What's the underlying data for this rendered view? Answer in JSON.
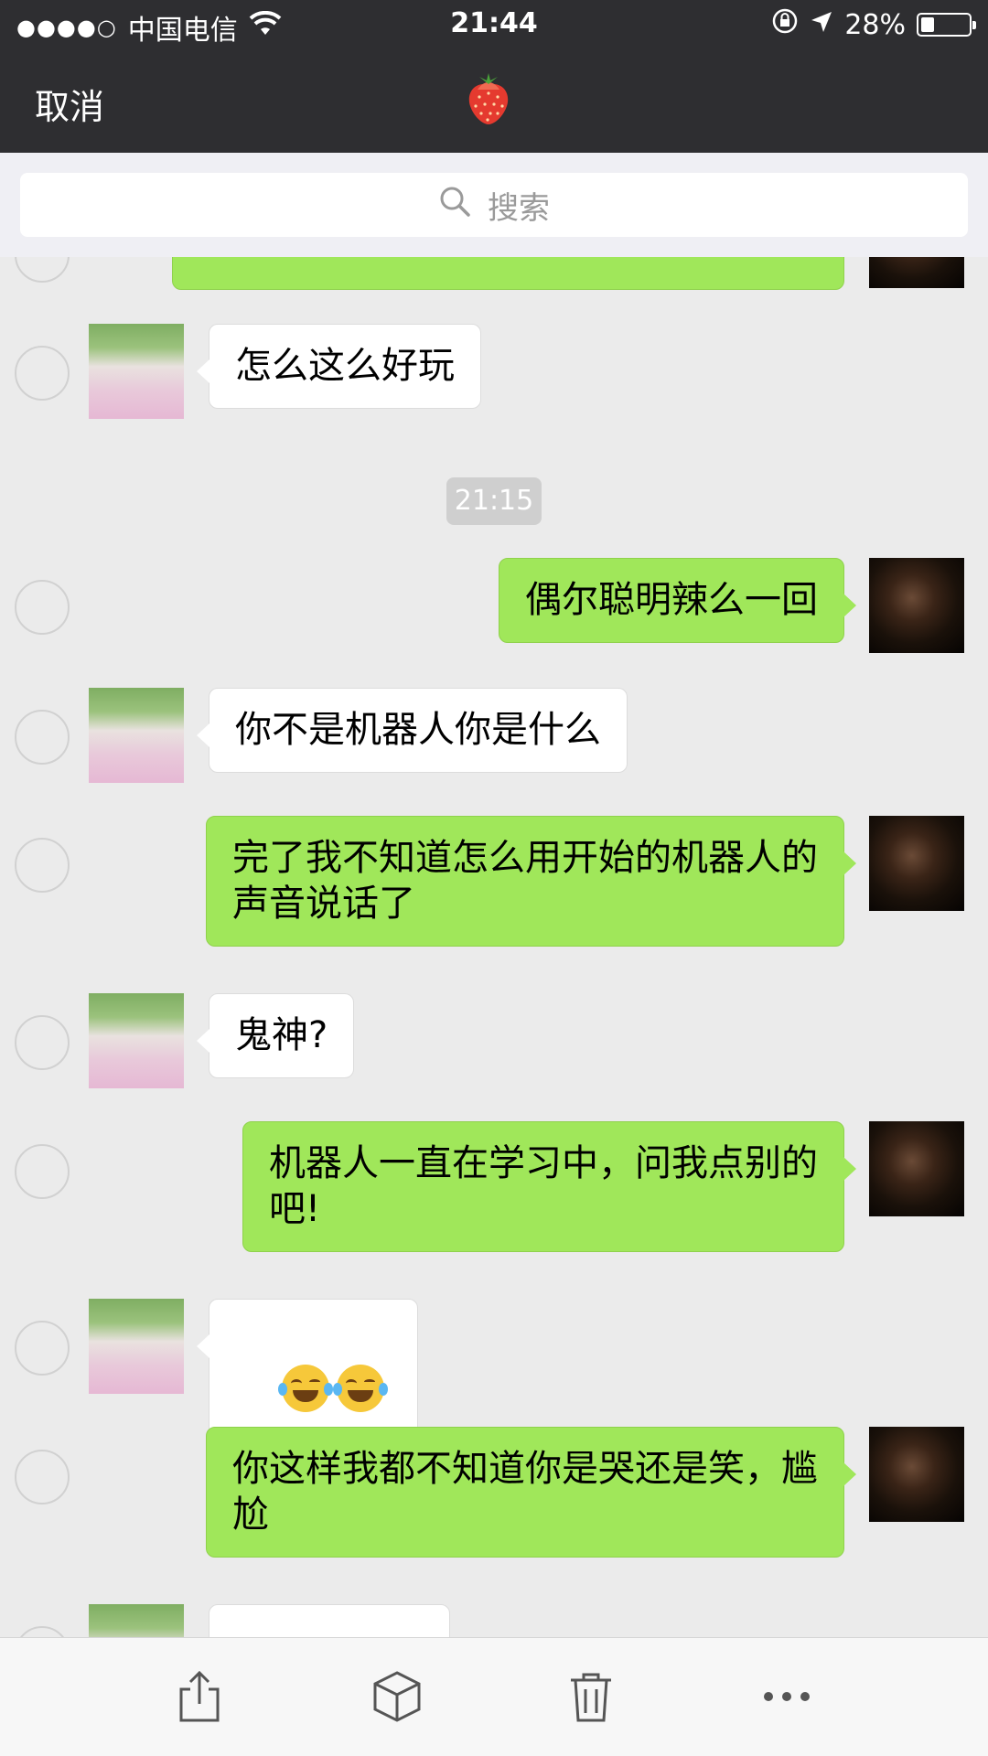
{
  "status_bar": {
    "signal": "●●●●○",
    "carrier": "中国电信",
    "time": "21:44",
    "battery": "28%",
    "battery_level": 0.28
  },
  "nav": {
    "cancel_label": "取消",
    "title_icon": "strawberry-icon"
  },
  "search": {
    "placeholder": "搜索"
  },
  "chat": {
    "timestamp": "21:15",
    "messages": [
      {
        "side": "left",
        "text": "怎么这么好玩"
      },
      {
        "side": "right",
        "text": "偶尔聪明辣么一回"
      },
      {
        "side": "left",
        "text": "你不是机器人你是什么"
      },
      {
        "side": "right",
        "text": "完了我不知道怎么用开始的机器人的\n声音说话了"
      },
      {
        "side": "left",
        "text": "鬼神?"
      },
      {
        "side": "right",
        "text": "机器人一直在学习中，问我点别的\n吧!"
      },
      {
        "side": "left",
        "text": "😂😂"
      },
      {
        "side": "right",
        "text": "你这样我都不知道你是哭还是笑，尴\n尬"
      }
    ]
  },
  "toolbar": {
    "icons": [
      "share-icon",
      "favorite-box-icon",
      "delete-icon",
      "more-icon"
    ]
  },
  "colors": {
    "nav_bg": "#2e2e31",
    "chat_bg": "#ebebeb",
    "bubble_sent": "#a0e75a",
    "bubble_received": "#ffffff"
  }
}
